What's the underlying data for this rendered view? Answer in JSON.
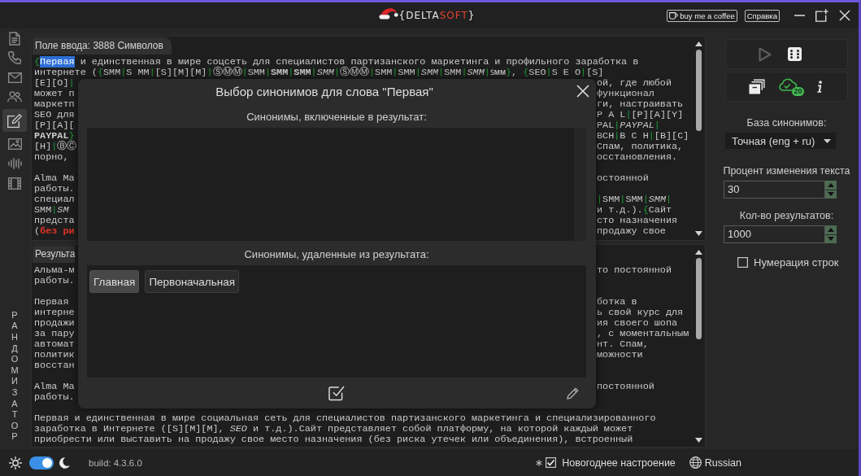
{
  "window": {
    "logo": {
      "text": "{DELTA",
      "accent": "SOFT",
      "end": "}"
    },
    "coffee_button": "buy me a coffee",
    "help_button": "Справка"
  },
  "sidebar": {
    "items": [
      {
        "kind": "document",
        "selected": false
      },
      {
        "kind": "phone",
        "selected": false
      },
      {
        "kind": "mail",
        "selected": false
      },
      {
        "kind": "people",
        "selected": false
      },
      {
        "kind": "edit",
        "selected": true
      },
      {
        "kind": "image",
        "selected": false
      },
      {
        "kind": "audio",
        "selected": false
      },
      {
        "kind": "video",
        "selected": false
      }
    ],
    "section_label": "РАНДОМИЗАТОР"
  },
  "input_editor": {
    "title": "Поле ввода: 3888 Символов",
    "paragraphs": [
      [
        {
          "left": [
            {
              "kind": "text",
              "text": "{"
            },
            {
              "kind": "selection",
              "text": "Первая"
            },
            {
              "kind": "text",
              "text": " и единственная в мире соцсеть для специалистов партизанского маркетинга и профильного заработка в"
            }
          ]
        },
        {
          "left": [
            {
              "kind": "text",
              "text": "интернете ({SMM|S MM|[S][M][M]|ⓈⓂⓂ|SMM|**SMM**|**SMM**|*SMM*|ⓈⓂⓂ|SMM|SMM|*SMM*|SMM|*SMM*|ꜱᴍᴍ}, {SEO|S E O|[S]"
            }
          ]
        },
        {
          "left": [
            {
              "kind": "text",
              "text": "[E][O]|"
            }
          ],
          "right": [
            {
              "kind": "text",
              "text": "ой, где любой"
            }
          ]
        },
        {
          "left": [
            {
              "kind": "text",
              "text": "может п"
            }
          ],
          "right": [
            {
              "kind": "text",
              "text": "функционал"
            }
          ]
        },
        {
          "left": [
            {
              "kind": "text",
              "text": "маркетп"
            }
          ],
          "right": [
            {
              "kind": "text",
              "text": "ги, настраивать"
            }
          ]
        },
        {
          "left": [
            {
              "kind": "text",
              "text": "SEO для"
            }
          ],
          "right": [
            {
              "kind": "text",
              "text": "P A L|[P][A][Y]"
            }
          ]
        },
        {
          "left": [
            {
              "kind": "text",
              "text": "[P][A]["
            }
          ],
          "right": [
            {
              "kind": "text",
              "text": "PAL|*PAYPAL*|"
            }
          ]
        },
        {
          "left": [
            {
              "kind": "text",
              "text": "**PAYPAL**}"
            }
          ],
          "right": [
            {
              "kind": "text",
              "text": "BCH|B C H|[B][C]"
            }
          ]
        },
        {
          "left": [
            {
              "kind": "text",
              "text": "[H]|ⒷⒸ"
            }
          ],
          "right": [
            {
              "kind": "text",
              "text": "Спам, политика,"
            }
          ]
        },
        {
          "left": [
            {
              "kind": "text",
              "text": "порно,"
            }
          ],
          "right": [
            {
              "kind": "text",
              "text": "осстановления."
            }
          ]
        }
      ],
      [
        {
          "left": [
            {
              "kind": "text",
              "text": "Alma Ma"
            }
          ],
          "right": [
            {
              "kind": "text",
              "text": "остоянной"
            }
          ]
        },
        {
          "left": [
            {
              "kind": "text",
              "text": "работы."
            }
          ]
        },
        {
          "left": [
            {
              "kind": "text",
              "text": "специал"
            }
          ],
          "right": [
            {
              "kind": "text",
              "text": "|SMM|SMM|*SMM*|"
            }
          ]
        },
        {
          "left": [
            {
              "kind": "text",
              "text": "SMM|*SM*"
            }
          ],
          "right": [
            {
              "kind": "text",
              "text": "и т.д.).{Сайт"
            }
          ]
        },
        {
          "left": [
            {
              "kind": "text",
              "text": "предста"
            }
          ],
          "right": [
            {
              "kind": "text",
              "text": "сто назначения"
            }
          ]
        },
        {
          "left": [
            {
              "kind": "text",
              "text": "("
            },
            {
              "kind": "warning",
              "text": "без ри"
            }
          ],
          "right": [
            {
              "kind": "text",
              "text": "продажу свое"
            }
          ]
        }
      ]
    ]
  },
  "result_editor": {
    "title": "Результа",
    "paragraphs": [
      [
        {
          "left": [
            {
              "kind": "text",
              "text": "Альма-м"
            }
          ],
          "right": [
            {
              "kind": "text",
              "text": "то постоянной"
            }
          ]
        },
        {
          "left": [
            {
              "kind": "text",
              "text": "работы."
            }
          ]
        }
      ],
      [
        {
          "left": [
            {
              "kind": "text",
              "text": "Первая"
            }
          ],
          "right": [
            {
              "kind": "text",
              "text": "ботка в"
            }
          ]
        },
        {
          "left": [
            {
              "kind": "text",
              "text": "интерне"
            }
          ],
          "right": [
            {
              "kind": "text",
              "text": "ь свой курс для"
            }
          ]
        },
        {
          "left": [
            {
              "kind": "text",
              "text": "продажи"
            }
          ],
          "right": [
            {
              "kind": "text",
              "text": "ия своего шопа"
            }
          ]
        },
        {
          "left": [
            {
              "kind": "text",
              "text": "за пару"
            }
          ],
          "right": [
            {
              "kind": "text",
              "text": ", с моментальным"
            }
          ]
        },
        {
          "left": [
            {
              "kind": "text",
              "text": "автомат"
            }
          ],
          "right": [
            {
              "kind": "text",
              "text": "нт. Спам,"
            }
          ]
        },
        {
          "left": [
            {
              "kind": "text",
              "text": "политик"
            }
          ],
          "right": [
            {
              "kind": "text",
              "text": "можности"
            }
          ]
        },
        {
          "left": [
            {
              "kind": "text",
              "text": "восстан"
            }
          ]
        }
      ],
      [
        {
          "left": [
            {
              "kind": "text",
              "text": "Alma Ma"
            }
          ],
          "right": [
            {
              "kind": "text",
              "text": "постоянной"
            }
          ]
        },
        {
          "left": [
            {
              "kind": "text",
              "text": "работы."
            }
          ]
        }
      ],
      [
        {
          "left": [
            {
              "kind": "text",
              "text": "Первая и единственная в мире социальная сеть для специалистов партизанского маркетинга и специализированного"
            }
          ]
        },
        {
          "left": [
            {
              "kind": "text",
              "text": "заработка в Интернете ([S][M][M], *SEO* и т.д.).Сайт представляет собой платформу, на которой каждый может"
            }
          ]
        },
        {
          "left": [
            {
              "kind": "text",
              "text": "приобрести или выставить на продажу свое место назначения (без риска утечек или объединения), встроенный"
            }
          ]
        }
      ]
    ]
  },
  "dialog": {
    "title": "Выбор синонимов для слова \"Первая\"",
    "included_label": "Синонимы, включенные в результат:",
    "removed_label": "Синонимы, удаленные из результата:",
    "removed": [
      {
        "label": "Главная",
        "selected": true
      },
      {
        "label": "Первоначальная",
        "selected": false
      }
    ]
  },
  "settings_panel": {
    "run_button": {
      "disabled": true
    },
    "cloud_badge": "20",
    "base_label": "База синонимов:",
    "base_value": "Точная (eng + ru)",
    "percent_label": "Процент изменения текста",
    "percent_value": "30",
    "count_label": "Кол-во результатов:",
    "count_value": "1000",
    "line_numbers": {
      "label": "Нумерация строк",
      "checked": false
    }
  },
  "status_bar": {
    "dark_mode": true,
    "build": "build: 4.3.6.0",
    "holiday_mode": {
      "label": "Новогоднее настроение",
      "checked": true
    },
    "language": "Russian"
  }
}
